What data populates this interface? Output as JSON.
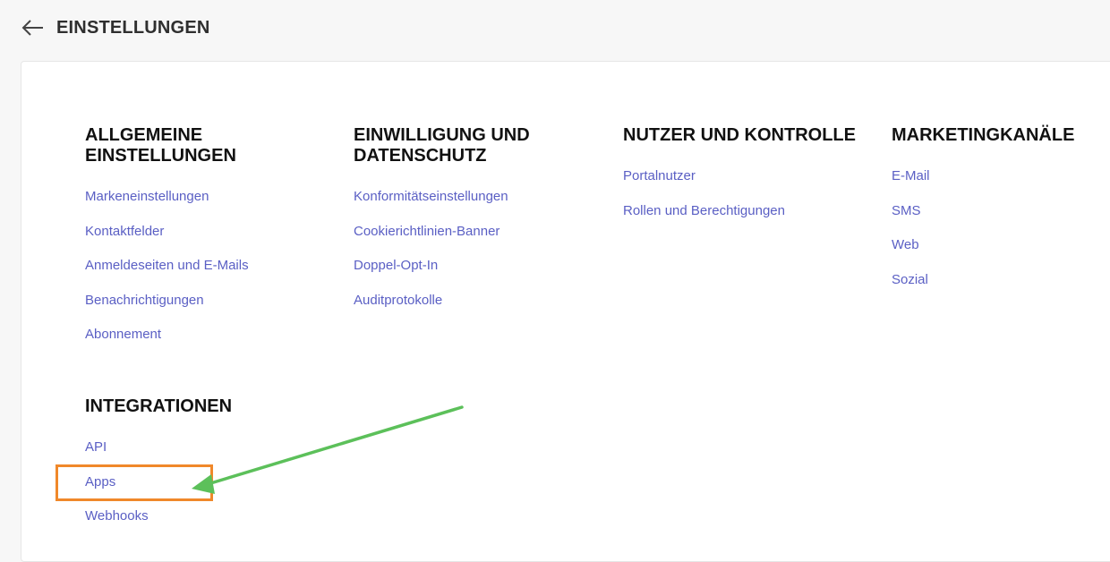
{
  "header": {
    "back_icon": "arrow-left-icon",
    "title": "EINSTELLUNGEN"
  },
  "sections": {
    "general": {
      "title": "ALLGEMEINE EINSTELLUNGEN",
      "items": [
        "Markeneinstellungen",
        "Kontaktfelder",
        "Anmeldeseiten und E-Mails",
        "Benachrichtigungen",
        "Abonnement"
      ]
    },
    "consent": {
      "title": "EINWILLIGUNG UND DATENSCHUTZ",
      "items": [
        "Konformitätseinstellungen",
        "Cookierichtlinien-Banner",
        "Doppel-Opt-In",
        "Auditprotokolle"
      ]
    },
    "users": {
      "title": "NUTZER UND KONTROLLE",
      "items": [
        "Portalnutzer",
        "Rollen und Berechtigungen"
      ]
    },
    "channels": {
      "title": "MARKETINGKANÄLE",
      "items": [
        "E-Mail",
        "SMS",
        "Web",
        "Sozial"
      ]
    },
    "integrations": {
      "title": "INTEGRATIONEN",
      "items": [
        "API",
        "Apps",
        "Webhooks"
      ]
    }
  },
  "annotation": {
    "highlight_color": "#f0882a",
    "arrow_color": "#5cc05a",
    "highlighted_item": "Apps"
  },
  "colors": {
    "link": "#5a5fc4",
    "heading": "#111111",
    "background": "#f7f7f7",
    "card": "#ffffff"
  }
}
